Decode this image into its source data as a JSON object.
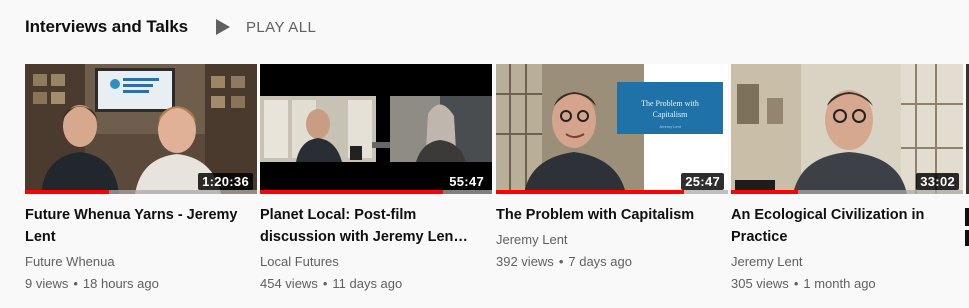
{
  "shelf": {
    "title": "Interviews and Talks",
    "play_all_label": "PLAY ALL",
    "play_icon": "play-icon"
  },
  "videos": [
    {
      "title": "Future Whenua Yarns - Jeremy Lent",
      "channel": "Future Whenua",
      "views": "9 views",
      "age": "18 hours ago",
      "duration": "1:20:36",
      "watched_fraction": 0.36
    },
    {
      "title": "Planet Local: Post-film discussion with Jeremy Len…",
      "channel": "Local Futures",
      "views": "454 views",
      "age": "11 days ago",
      "duration": "55:47",
      "watched_fraction": 0.79
    },
    {
      "title": "The Problem with Capitalism",
      "channel": "Jeremy Lent",
      "views": "392 views",
      "age": "7 days ago",
      "duration": "25:47",
      "watched_fraction": 0.81,
      "slide_title": "The Problem with Capitalism",
      "slide_subtitle": "Jeremy Lent"
    },
    {
      "title": "An Ecological Civilization in Practice",
      "channel": "Jeremy Lent",
      "views": "305 views",
      "age": "1 month ago",
      "duration": "33:02",
      "watched_fraction": 0.29
    }
  ],
  "separator": "•",
  "colors": {
    "background": "#f9f9f9",
    "progress": "#ff0000",
    "text_primary": "#0f0f0f",
    "text_secondary": "#606060"
  }
}
